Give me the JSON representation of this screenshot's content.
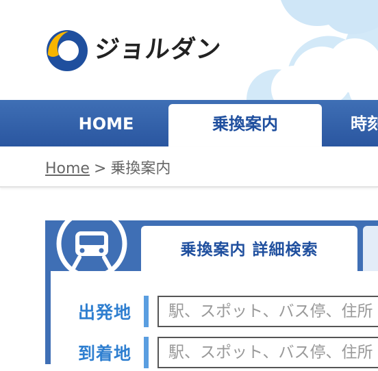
{
  "logo": {
    "text": "ジョルダン",
    "colors": {
      "blue": "#1f4f9e",
      "yellow": "#f7b500"
    }
  },
  "nav": {
    "items": [
      {
        "label": "HOME",
        "active": false
      },
      {
        "label": "乗換案内",
        "active": true
      },
      {
        "label": "時刻",
        "active": false
      }
    ]
  },
  "breadcrumb": {
    "home": "Home",
    "separator": ">",
    "current": "乗換案内"
  },
  "search": {
    "tab_label": "乗換案内 詳細検索",
    "departure": {
      "label": "出発地",
      "placeholder": "駅、スポット、バス停、住所"
    },
    "arrival": {
      "label": "到着地",
      "placeholder": "駅、スポット、バス停、住所"
    }
  },
  "colors": {
    "nav_blue": "#3f6fb5",
    "accent_blue": "#1f4f9e",
    "label_blue": "#2f7fd0",
    "sky": "#cfe6f7"
  },
  "icons": [
    "logo-mark-icon",
    "train-icon"
  ]
}
